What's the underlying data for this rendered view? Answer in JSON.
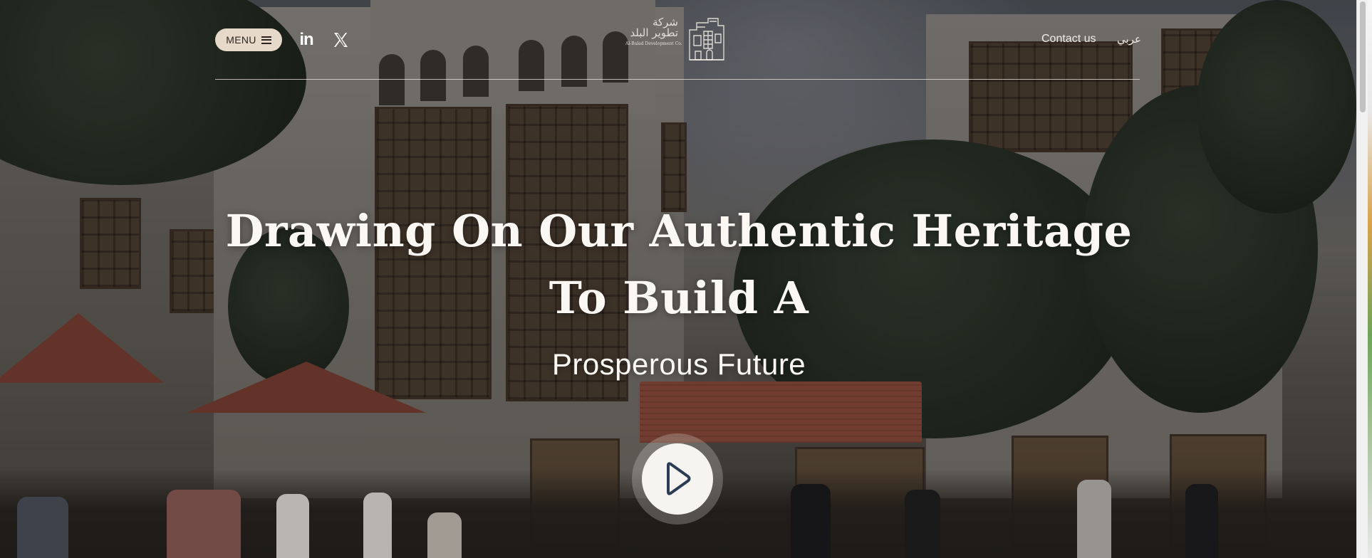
{
  "header": {
    "menu_label": "MENU",
    "linkedin_label": "in",
    "logo": {
      "arabic": "شركة تطوير البلد",
      "english": "Al-Balad Development Co."
    },
    "contact_label": "Contact us",
    "language_label": "عربي"
  },
  "hero": {
    "headline_line1": "Drawing On Our Authentic Heritage",
    "headline_line2": "To Build A",
    "subheadline": "Prosperous Future"
  },
  "icons": {
    "menu": "hamburger-icon",
    "linkedin": "linkedin-icon",
    "x": "x-icon",
    "logo_mark": "building-logo-icon",
    "play": "play-icon"
  },
  "colors": {
    "menu_pill": "#e7d9c9",
    "headline_text": "#fbf8f3",
    "play_button": "#f6f4f1",
    "play_glyph": "#2c3c55"
  }
}
